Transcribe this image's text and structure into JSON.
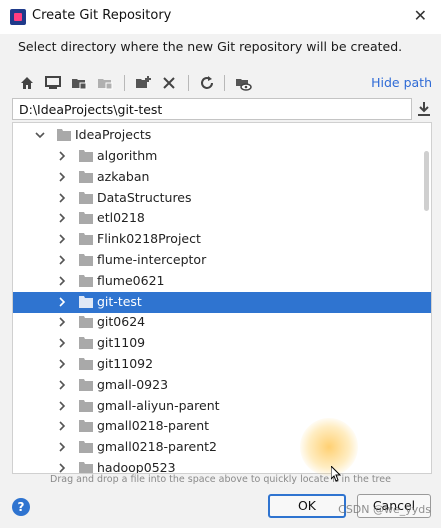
{
  "window": {
    "title": "Create Git Repository",
    "close_glyph": "✕"
  },
  "subtitle": "Select directory where the new Git repository will be created.",
  "toolbar": {
    "icons": [
      "home-icon",
      "desktop-icon",
      "project-folder-icon",
      "module-folder-icon",
      "new-folder-icon",
      "delete-icon",
      "refresh-icon",
      "show-hidden-icon"
    ],
    "hide_path_label": "Hide path"
  },
  "path": {
    "value": "D:\\IdeaProjects\\git-test"
  },
  "tree": {
    "root": "IdeaProjects",
    "items": [
      {
        "label": "algorithm"
      },
      {
        "label": "azkaban"
      },
      {
        "label": "DataStructures"
      },
      {
        "label": "etl0218"
      },
      {
        "label": "Flink0218Project"
      },
      {
        "label": "flume-interceptor"
      },
      {
        "label": "flume0621"
      },
      {
        "label": "git-test",
        "selected": true
      },
      {
        "label": "git0624"
      },
      {
        "label": "git1109"
      },
      {
        "label": "git11092"
      },
      {
        "label": "gmall-0923"
      },
      {
        "label": "gmall-aliyun-parent"
      },
      {
        "label": "gmall0218-parent"
      },
      {
        "label": "gmall0218-parent2"
      },
      {
        "label": "hadoop0523"
      }
    ]
  },
  "hint": "Drag and drop a file into the space above to quickly locate it in the tree",
  "buttons": {
    "help": "?",
    "ok": "OK",
    "cancel": "Cancel"
  },
  "watermark": "CSDN @we_yyds",
  "colors": {
    "accent": "#2f74d0",
    "link": "#2f6bd6",
    "folder": "#a9a9a9"
  }
}
